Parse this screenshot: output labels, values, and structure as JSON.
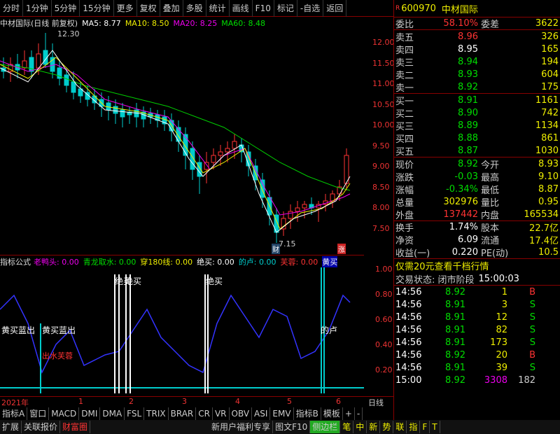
{
  "toolbar": [
    "分时",
    "1分钟",
    "5分钟",
    "15分钟",
    "更多",
    "复权",
    "叠加",
    "多股",
    "统计",
    "画线",
    "F10",
    "标记",
    "-自选",
    "返回"
  ],
  "chart_title": {
    "name": "中材国际(日线 前复权)",
    "ma5": "MA5: 8.77",
    "ma10": "MA10: 8.50",
    "ma20": "MA20: 8.25",
    "ma60": "MA60: 8.48"
  },
  "price_axis": [
    "12.00",
    "11.50",
    "11.00",
    "10.50",
    "10.00",
    "9.50",
    "9.00",
    "8.50",
    "8.00",
    "7.50"
  ],
  "annotations": {
    "high": "12.30",
    "low": "7.15",
    "cai": "财",
    "zhang": "涨"
  },
  "indicator_title": {
    "label": "指标公式",
    "lyt": "老鸭头: 0.00",
    "qlqs": "青龙取水: 0.00",
    "c180": "穿180线: 0.00",
    "jm": "绝买: 0.00",
    "dd": "的卢: 0.00",
    "fr": "芙蓉: 0.00",
    "hl": "黄买"
  },
  "ind_axis": [
    "1.00",
    "0.80",
    "0.60",
    "0.40",
    "0.20"
  ],
  "ind_labels": {
    "a": "黄买蓝出",
    "b": "黄买蓝出",
    "c": "出水芙蓉",
    "d": "绝买",
    "e": "绝买",
    "f": "绝买",
    "g": "的卢"
  },
  "timeline": [
    "2021年",
    "1",
    "2",
    "3",
    "4",
    "5",
    "6",
    "日线"
  ],
  "tabs1": [
    "指标A",
    "窗口",
    "MACD",
    "DMI",
    "DMA",
    "FSL",
    "TRIX",
    "BRAR",
    "CR",
    "VR",
    "OBV",
    "ASI",
    "EMV",
    "指标B",
    "模板",
    "+",
    "-"
  ],
  "tabs2": [
    "扩展",
    "关联报价",
    "财富圈",
    "新用户福利专享",
    "图文F10",
    "侧边栏",
    "笔",
    "中",
    "新",
    "势",
    "联",
    "指",
    "F",
    "T"
  ],
  "stock": {
    "code": "600970",
    "name": "中材国际"
  },
  "weibi": {
    "label": "委比",
    "value": "58.10%",
    "label2": "委差",
    "value2": "3622"
  },
  "sells": [
    {
      "l": "卖五",
      "p": "8.96",
      "v": "326"
    },
    {
      "l": "卖四",
      "p": "8.95",
      "v": "165"
    },
    {
      "l": "卖三",
      "p": "8.94",
      "v": "194"
    },
    {
      "l": "卖二",
      "p": "8.93",
      "v": "604"
    },
    {
      "l": "卖一",
      "p": "8.92",
      "v": "175"
    }
  ],
  "buys": [
    {
      "l": "买一",
      "p": "8.91",
      "v": "1161"
    },
    {
      "l": "买二",
      "p": "8.90",
      "v": "742"
    },
    {
      "l": "买三",
      "p": "8.89",
      "v": "1134"
    },
    {
      "l": "买四",
      "p": "8.88",
      "v": "861"
    },
    {
      "l": "买五",
      "p": "8.87",
      "v": "1030"
    }
  ],
  "quote": [
    {
      "a": "现价",
      "b": "8.92",
      "c": "今开",
      "d": "8.93"
    },
    {
      "a": "涨跌",
      "b": "-0.03",
      "c": "最高",
      "d": "9.10"
    },
    {
      "a": "涨幅",
      "b": "-0.34%",
      "c": "最低",
      "d": "8.87"
    },
    {
      "a": "总量",
      "b": "302976",
      "c": "量比",
      "d": "0.95"
    },
    {
      "a": "外盘",
      "b": "137442",
      "c": "内盘",
      "d": "165534"
    },
    {
      "a": "换手",
      "b": "1.74%",
      "c": "股本",
      "d": "22.7亿"
    },
    {
      "a": "净资",
      "b": "6.09",
      "c": "流通",
      "d": "17.4亿"
    },
    {
      "a": "收益(一)",
      "b": "0.220",
      "c": "PE(动)",
      "d": "10.5"
    }
  ],
  "promo": "仅需20元查看千档行情",
  "status": {
    "label": "交易状态: 闭市阶段",
    "time": "15:00:03"
  },
  "ticks": [
    {
      "t": "14:56",
      "p": "8.92",
      "v": "1",
      "d": "B"
    },
    {
      "t": "14:56",
      "p": "8.91",
      "v": "3",
      "d": "S"
    },
    {
      "t": "14:56",
      "p": "8.91",
      "v": "12",
      "d": "S"
    },
    {
      "t": "14:56",
      "p": "8.91",
      "v": "82",
      "d": "S"
    },
    {
      "t": "14:56",
      "p": "8.91",
      "v": "173",
      "d": "S"
    },
    {
      "t": "14:56",
      "p": "8.92",
      "v": "20",
      "d": "B"
    },
    {
      "t": "14:56",
      "p": "8.91",
      "v": "39",
      "d": "S"
    },
    {
      "t": "15:00",
      "p": "8.92",
      "v": "3308",
      "d": "182"
    }
  ]
}
